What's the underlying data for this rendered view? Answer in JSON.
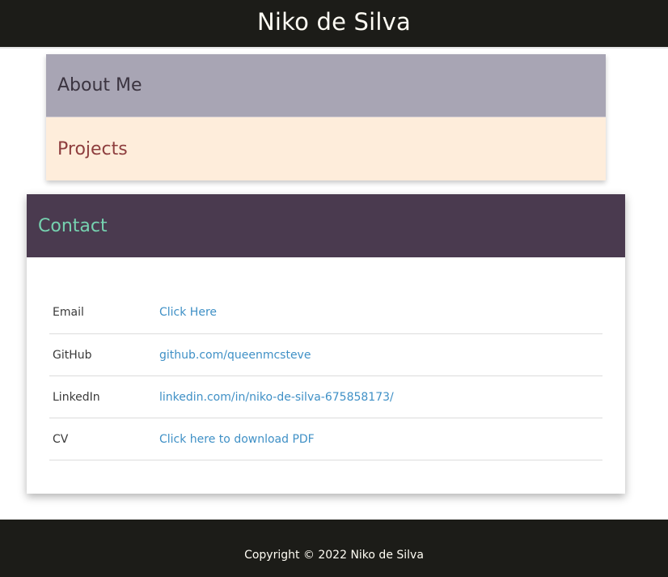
{
  "header": {
    "title": "Niko de Silva"
  },
  "panels": {
    "about": "About Me",
    "projects": "Projects",
    "contact": "Contact"
  },
  "contact": {
    "rows": [
      {
        "label": "Email",
        "value": "Click Here"
      },
      {
        "label": "GitHub",
        "value": "github.com/queenmcsteve"
      },
      {
        "label": "LinkedIn",
        "value": "linkedin.com/in/niko-de-silva-675858173/"
      },
      {
        "label": "CV",
        "value": "Click here to download PDF"
      }
    ]
  },
  "footer": {
    "copyright": "Copyright © 2022 Niko de Silva"
  },
  "colors": {
    "header_bg": "#1c1c18",
    "about_bg": "#a8a5b4",
    "projects_bg": "#feeddb",
    "contact_bg": "#4a3a4f",
    "contact_title": "#76d2b0",
    "link": "#3f90c6"
  }
}
